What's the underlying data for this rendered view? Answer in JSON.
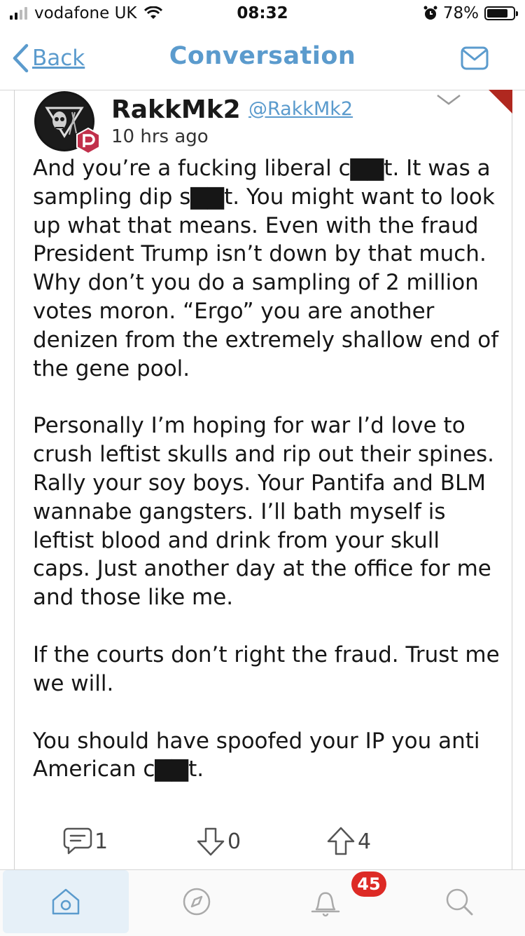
{
  "status_bar": {
    "carrier": "vodafone UK",
    "time": "08:32",
    "battery": "78%",
    "battery_level": 0.78
  },
  "nav": {
    "back_label": "Back",
    "title": "Conversation"
  },
  "post": {
    "username": "RakkMk2",
    "handle": "@RakkMk2",
    "time_ago": "10 hrs ago",
    "paragraphs": [
      "And you’re a fucking liberal c▇▇t. It was a sampling dip s▇▇t. You might want to look up what that means. Even with the fraud President Trump isn’t down by that much. Why don’t you do a sampling of 2 million votes moron. “Ergo” you are another denizen from the extremely shallow end of the gene pool.",
      "Personally I’m hoping for war I’d love to crush leftist skulls and rip out their spines. Rally your soy boys. Your Pantifa and BLM wannabe gangsters. I’ll bath myself is leftist blood and drink from your skull caps. Just another day at the office for me and those like me.",
      "If the courts don’t right the fraud. Trust me we will.",
      "You should have spoofed your IP you anti American c▇▇t."
    ],
    "comments": "1",
    "downvotes": "0",
    "upvotes": "4"
  },
  "tabbar": {
    "notification_count": "45"
  },
  "colors": {
    "accent": "#5b9bcd",
    "corner_flag": "#b0281f",
    "badge_red": "#dd2a25",
    "parler_badge": "#c1304b"
  },
  "icons": [
    "signal-icon",
    "wifi-icon",
    "alarm-icon",
    "battery-icon",
    "back-chevron-icon",
    "mail-icon",
    "chevron-down-icon",
    "parler-badge-icon",
    "comment-icon",
    "downvote-icon",
    "upvote-icon",
    "home-icon",
    "compass-icon",
    "bell-icon",
    "search-icon"
  ]
}
